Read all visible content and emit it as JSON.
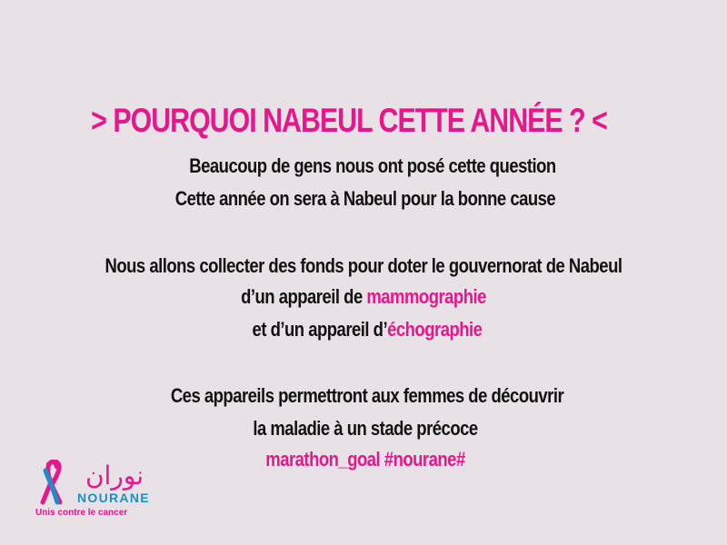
{
  "colors": {
    "background": "#e8e2e6",
    "accent": "#e5178a",
    "text": "#121212",
    "logo_blue": "#1c8fc7"
  },
  "title": "> POURQUOI NABEUL CETTE ANNÉE ? <",
  "paragraphs": {
    "line1": "Beaucoup de gens nous ont posé cette question",
    "line2": "Cette année on sera à Nabeul pour la bonne cause",
    "line3": "Nous allons collecter des fonds pour doter le gouvernorat de Nabeul",
    "line4_prefix": "d’un appareil de ",
    "line4_highlight": "mammographie",
    "line5_prefix": "et d’un appareil d’",
    "line5_highlight": "échographie",
    "line6": "Ces appareils permettront aux femmes de découvrir",
    "line7": "la maladie à un stade précoce",
    "line8": "marathon_goal  #nourane#"
  },
  "logo": {
    "arabic": "نوران",
    "name": "NOURANE",
    "tagline": "Unis contre le cancer",
    "ribbon_icon": "pink-blue-ribbon-icon"
  }
}
